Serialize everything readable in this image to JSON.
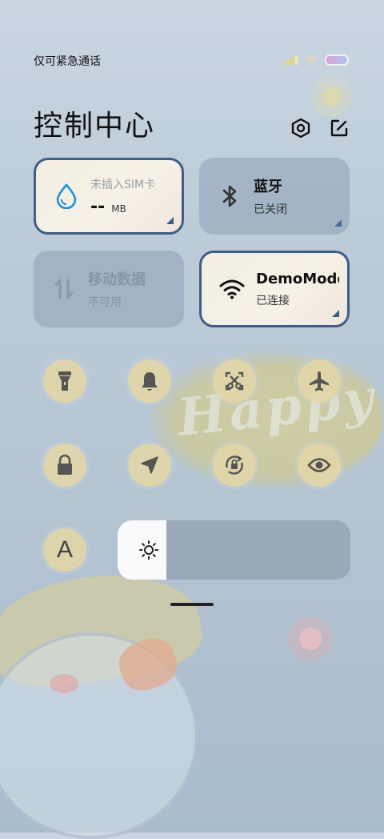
{
  "status_bar": {
    "carrier_text": "仅可紧急通话",
    "battery_colors": [
      "#d8a0d8",
      "#b0c8f0"
    ]
  },
  "header": {
    "title": "控制中心",
    "settings_icon": "gear-hex-icon",
    "edit_icon": "edit-icon"
  },
  "tiles": {
    "sim": {
      "title": "未插入SIM卡",
      "usage": "--",
      "unit": "MB",
      "icon": "water-drop-icon",
      "active": true
    },
    "bluetooth": {
      "label": "蓝牙",
      "status": "已关闭",
      "icon": "bluetooth-icon",
      "active": false
    },
    "mobile_data": {
      "label": "移动数据",
      "status": "不可用",
      "icon": "data-arrows-icon",
      "active": false
    },
    "wifi": {
      "label": "DemoMode",
      "status": "已连接",
      "icon": "wifi-icon",
      "active": true
    }
  },
  "toggles": [
    {
      "name": "flashlight",
      "icon": "flashlight-icon"
    },
    {
      "name": "mute",
      "icon": "bell-icon"
    },
    {
      "name": "screenshot",
      "icon": "screenshot-scissors-icon"
    },
    {
      "name": "airplane-mode",
      "icon": "airplane-icon"
    },
    {
      "name": "lock-screen",
      "icon": "lock-icon"
    },
    {
      "name": "location",
      "icon": "location-arrow-icon"
    },
    {
      "name": "auto-rotate",
      "icon": "rotation-lock-icon"
    },
    {
      "name": "reading-mode",
      "icon": "eye-icon"
    }
  ],
  "font_toggle": {
    "label": "A",
    "icon": "font-size-icon"
  },
  "brightness": {
    "level": 0.21,
    "icon": "sun-icon"
  },
  "colors": {
    "accent": "#3e5e86",
    "toggle_bg": "#e2d6a8",
    "wifi_blue": "#1f8fe0"
  }
}
